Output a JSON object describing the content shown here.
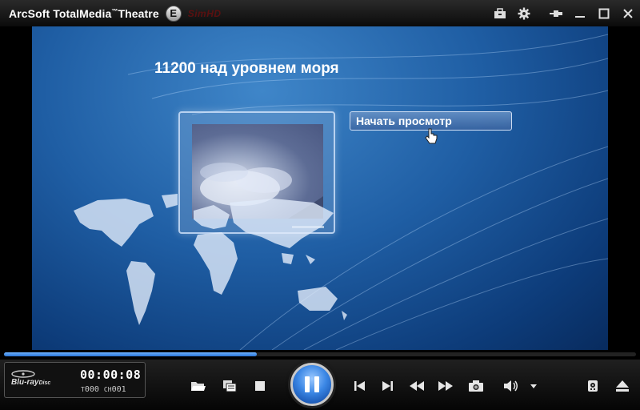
{
  "window": {
    "app_name": "ArcSoft TotalMedia",
    "app_suffix": "Theatre",
    "tm_mark": "™",
    "edition_badge": "E",
    "simhd_label": "SimHD",
    "titlebar_icons": [
      "toolbox-icon",
      "gear-icon",
      "pin-icon",
      "minimize-icon",
      "maximize-icon",
      "close-icon"
    ]
  },
  "video": {
    "menu_title": "11200 над уровнем моря",
    "play_button_label": "Начать просмотр"
  },
  "playback": {
    "progress_fraction": 0.4,
    "time": "00:00:08",
    "title_label": "T",
    "title_value": "000",
    "chapter_label": "CH",
    "chapter_value": "001",
    "logo_text": "Blu-ray",
    "logo_sub": "Disc"
  },
  "colors": {
    "accent": "#3b87e5",
    "progress": "#4a93f0"
  }
}
